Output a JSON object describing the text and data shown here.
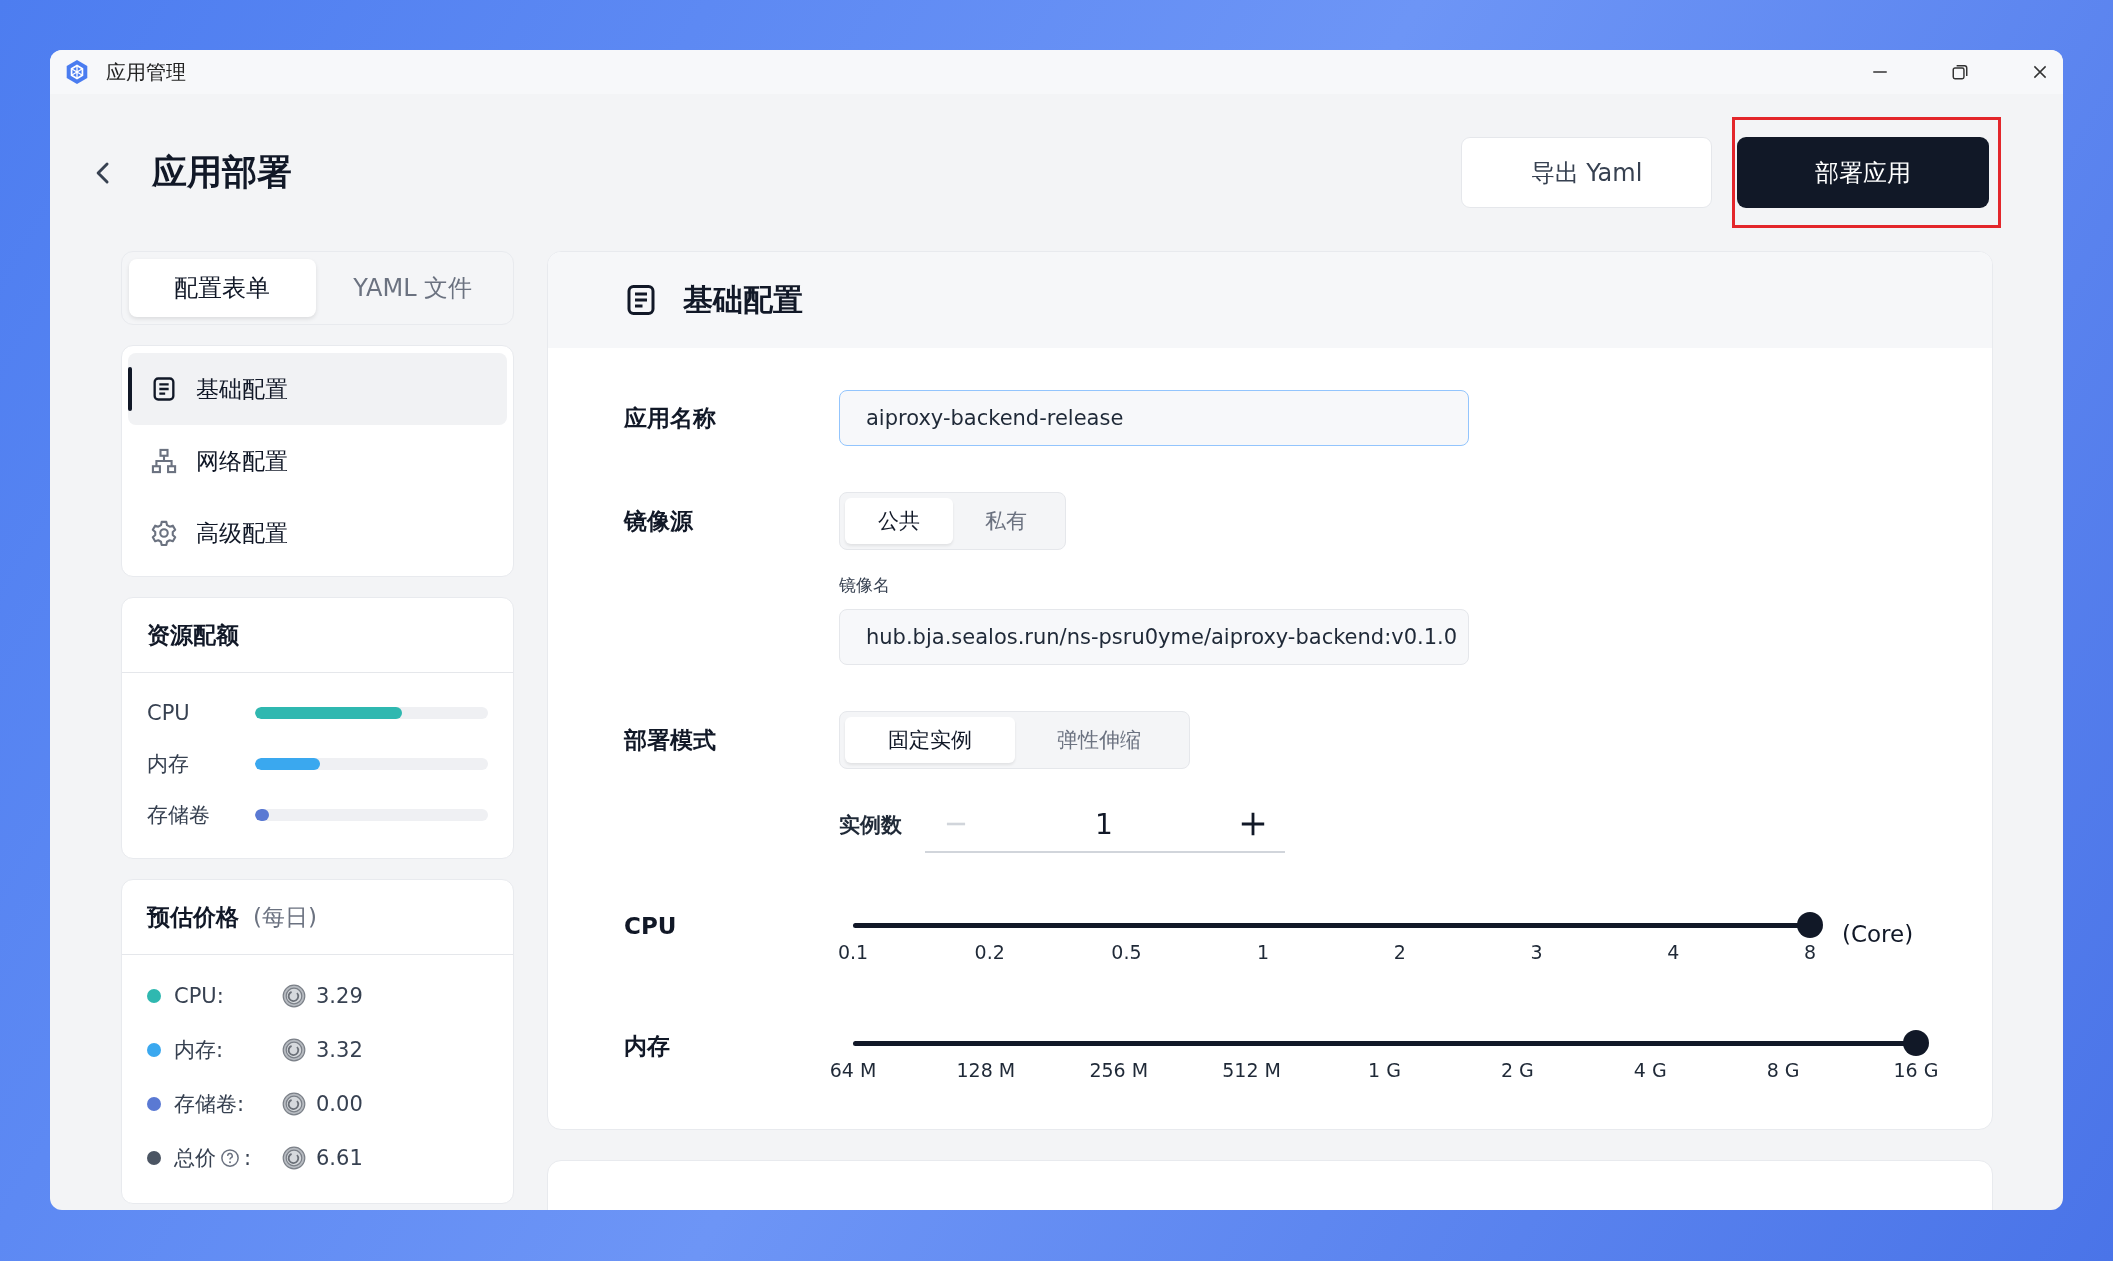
{
  "window": {
    "title": "应用管理"
  },
  "header": {
    "title": "应用部署",
    "buttons": [
      {
        "label": "导出 Yaml",
        "kind": "secondary",
        "highlighted": false
      },
      {
        "label": "部署应用",
        "kind": "primary",
        "highlighted": true
      }
    ]
  },
  "mode_tabs": [
    {
      "label": "配置表单",
      "selected": true
    },
    {
      "label": "YAML 文件",
      "selected": false
    }
  ],
  "nav": [
    {
      "label": "基础配置",
      "selected": true
    },
    {
      "label": "网络配置",
      "selected": false
    },
    {
      "label": "高级配置",
      "selected": false
    }
  ],
  "quota": {
    "title": "资源配额",
    "items": [
      {
        "label": "CPU",
        "level": 0.63,
        "color": "#2fb8b0"
      },
      {
        "label": "内存",
        "level": 0.28,
        "color": "#3aa8ef"
      },
      {
        "label": "存储卷",
        "level": 0.06,
        "color": "#5a79d3"
      }
    ]
  },
  "price": {
    "title": "预估价格",
    "note": "(每日)",
    "items": [
      {
        "label": "CPU:",
        "value": "3.29",
        "color": "#2fb8b0",
        "help": false
      },
      {
        "label": "内存:",
        "value": "3.32",
        "color": "#3aa8ef",
        "help": false
      },
      {
        "label": "存储卷:",
        "value": "0.00",
        "color": "#5a79d3",
        "help": false
      },
      {
        "label": "总价",
        "suffix": ":",
        "value": "6.61",
        "color": "#4b5563",
        "help": true
      }
    ]
  },
  "basic": {
    "title": "基础配置",
    "app_name": {
      "label": "应用名称",
      "value": "aiproxy-backend-release"
    },
    "image_source": {
      "label": "镜像源",
      "options": [
        {
          "label": "公共",
          "selected": true
        },
        {
          "label": "私有",
          "selected": false
        }
      ]
    },
    "image_name": {
      "label": "镜像名",
      "value": "hub.bja.sealos.run/ns-psru0yme/aiproxy-backend:v0.1.0"
    },
    "deploy_mode": {
      "label": "部署模式",
      "options": [
        {
          "label": "固定实例",
          "selected": true
        },
        {
          "label": "弹性伸缩",
          "selected": false
        }
      ]
    },
    "replicas": {
      "label": "实例数",
      "value": "1",
      "decrement_disabled": true
    },
    "sliders": [
      {
        "label": "CPU",
        "level": 1,
        "ticks": [
          "0.1",
          "0.2",
          "0.5",
          "1",
          "2",
          "3",
          "4",
          "8"
        ],
        "unit": "(Core)"
      },
      {
        "label": "内存",
        "level": 1,
        "ticks": [
          "64 M",
          "128 M",
          "256 M",
          "512 M",
          "1 G",
          "2 G",
          "4 G",
          "8 G",
          "16 G"
        ]
      }
    ]
  }
}
